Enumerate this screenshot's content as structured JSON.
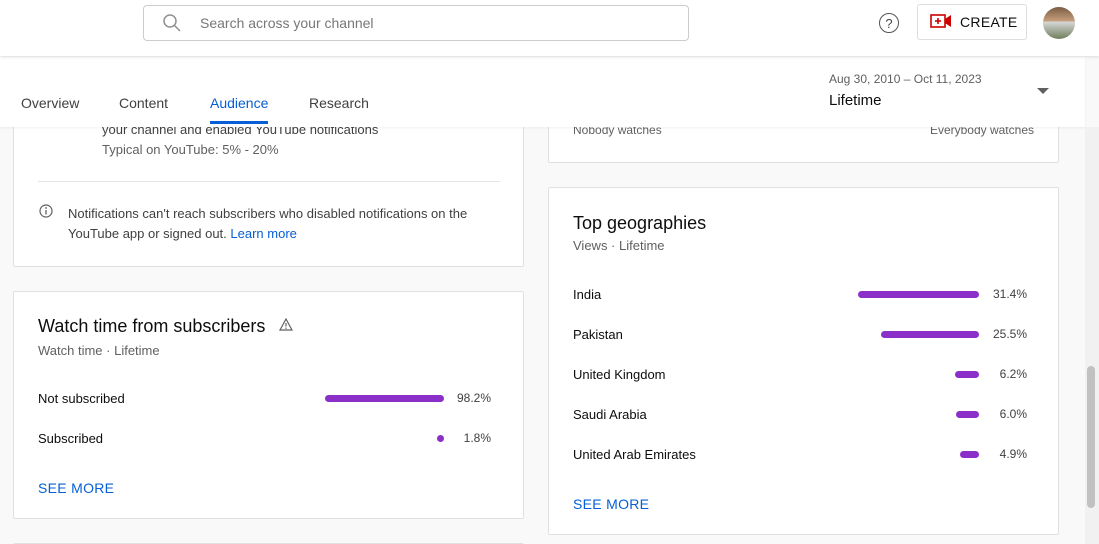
{
  "header": {
    "search_placeholder": "Search across your channel",
    "help_label": "?",
    "create_label": "CREATE"
  },
  "tabs": [
    {
      "label": "Overview"
    },
    {
      "label": "Content"
    },
    {
      "label": "Audience"
    },
    {
      "label": "Research"
    }
  ],
  "date_range": {
    "range": "Aug 30, 2010 – Oct 11, 2023",
    "period": "Lifetime"
  },
  "notifications_card": {
    "desc_partial": "your channel and enabled YouTube notifications",
    "typical": "Typical on YouTube: 5% - 20%",
    "note": "Notifications can't reach subscribers who disabled notifications on the YouTube app or signed out.",
    "learn_more": "Learn more"
  },
  "watch_card_top": {
    "left_label": "Nobody watches",
    "right_label": "Everybody watches"
  },
  "watch_time_subs": {
    "title": "Watch time from subscribers",
    "subtitle": "Watch time · Lifetime",
    "rows": [
      {
        "label": "Not subscribed",
        "pct": "98.2%",
        "value": 98.2
      },
      {
        "label": "Subscribed",
        "pct": "1.8%",
        "value": 1.8
      }
    ],
    "see_more": "SEE MORE"
  },
  "top_geographies": {
    "title": "Top geographies",
    "subtitle": "Views · Lifetime",
    "rows": [
      {
        "label": "India",
        "pct": "31.4%",
        "value": 31.4
      },
      {
        "label": "Pakistan",
        "pct": "25.5%",
        "value": 25.5
      },
      {
        "label": "United Kingdom",
        "pct": "6.2%",
        "value": 6.2
      },
      {
        "label": "Saudi Arabia",
        "pct": "6.0%",
        "value": 6.0
      },
      {
        "label": "United Arab Emirates",
        "pct": "4.9%",
        "value": 4.9
      }
    ],
    "see_more": "SEE MORE"
  },
  "colors": {
    "accent": "#065fd4",
    "bar": "#8b2fc9"
  }
}
